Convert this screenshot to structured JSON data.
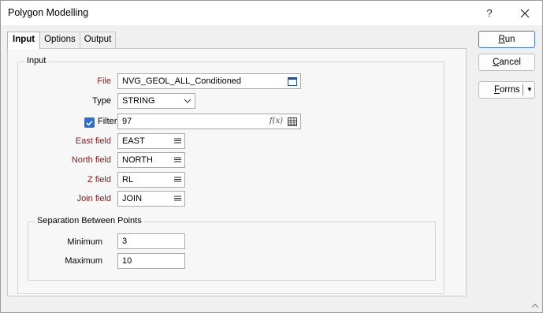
{
  "window": {
    "title": "Polygon Modelling",
    "help_glyph": "?",
    "close_glyph": "✕"
  },
  "tabs": [
    {
      "label": "Input"
    },
    {
      "label": "Options"
    },
    {
      "label": "Output"
    }
  ],
  "input_group": {
    "title": "Input",
    "file": {
      "label": "File",
      "value": "NVG_GEOL_ALL_Conditioned",
      "icon": "file-browse-icon"
    },
    "type": {
      "label": "Type",
      "value": "STRING",
      "icon": "chevron-down-icon"
    },
    "filter": {
      "label": "Filter",
      "checked": true,
      "value": "97",
      "fx_glyph": "f(x)",
      "icon": "table-icon"
    },
    "east": {
      "label": "East field",
      "value": "EAST",
      "icon": "list-icon"
    },
    "north": {
      "label": "North field",
      "value": "NORTH",
      "icon": "list-icon"
    },
    "z": {
      "label": "Z field",
      "value": "RL",
      "icon": "list-icon"
    },
    "join": {
      "label": "Join field",
      "value": "JOIN",
      "icon": "list-icon"
    }
  },
  "separation_group": {
    "title": "Separation Between Points",
    "minimum": {
      "label": "Minimum",
      "value": "3"
    },
    "maximum": {
      "label": "Maximum",
      "value": "10"
    }
  },
  "buttons": {
    "run": {
      "underlined": "R",
      "rest": "un"
    },
    "cancel": {
      "underlined": "C",
      "rest": "ancel"
    },
    "forms": {
      "underlined": "F",
      "rest": "orms"
    }
  },
  "colors": {
    "required_label": "#8b1a1a",
    "accent": "#2a6fd0"
  }
}
